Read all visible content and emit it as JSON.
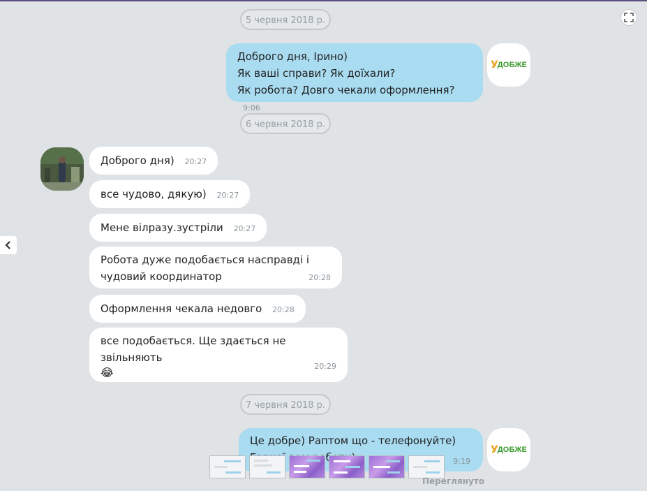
{
  "dates": [
    "5 червня 2018 р.",
    "6 червня 2018 р.",
    "7 червня 2018 р."
  ],
  "brand": {
    "logo_text": "ДОБЖЕ",
    "logo_mark": "У",
    "logo_color": "#3a9a2c",
    "mark_color": "#e7a21b"
  },
  "messages": [
    {
      "lines": [
        "Доброго дня, Ірино)",
        "Як ваші справи? Як доїхали?",
        "Як робота? Довго чекали оформлення?"
      ],
      "time": "9:06"
    },
    {
      "text": "Доброго дня)",
      "time": "20:27"
    },
    {
      "text": "все чудово, дякую)",
      "time": "20:27"
    },
    {
      "text": "Мене вілразу.зустріли",
      "time": "20:27"
    },
    {
      "lines": [
        "Робота дуже подобається насправді і",
        "чудовий координатор"
      ],
      "time": "20:28"
    },
    {
      "text": "Оформлення чекала недовго",
      "time": "20:28"
    },
    {
      "text": "все подобається. Ще здається не звільняють",
      "emoji": "😂",
      "time": "20:29"
    },
    {
      "lines": [
        "Це добре) Раптом що - телефонуйте)",
        "Гарної вам роботи)"
      ],
      "time": "9:19"
    }
  ],
  "status": {
    "viewed": "Переглянуто"
  },
  "icons": {
    "fullscreen": "fullscreen-icon",
    "nav_left": "chevron-left-icon"
  },
  "colors": {
    "background": "#dfe3e6",
    "outgoing": "#a9dcf1",
    "incoming": "#ffffff"
  }
}
